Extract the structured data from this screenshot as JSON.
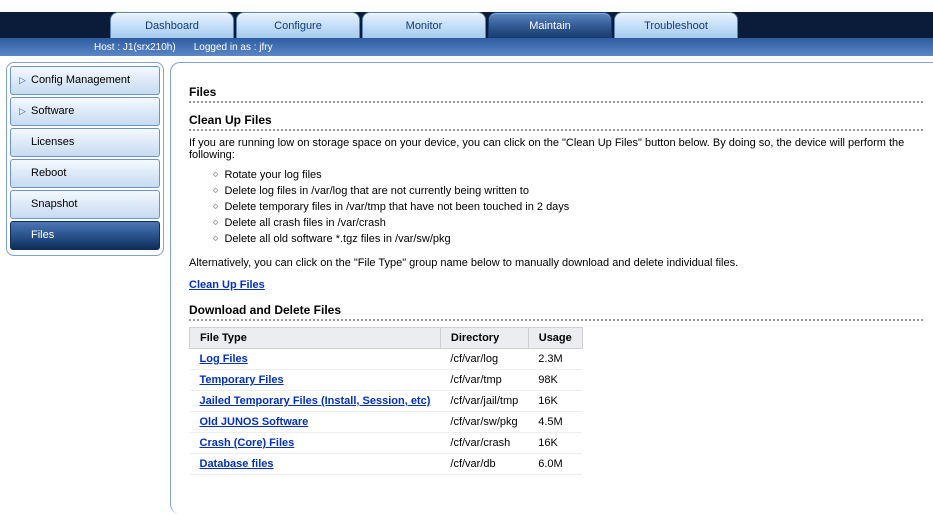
{
  "tabs": {
    "dashboard": "Dashboard",
    "configure": "Configure",
    "monitor": "Monitor",
    "maintain": "Maintain",
    "troubleshoot": "Troubleshoot"
  },
  "status": {
    "host": "Host : J1(srx210h)",
    "logged_in": "Logged in as : jfry"
  },
  "sidebar": {
    "config_mgmt": "Config Management",
    "software": "Software",
    "licenses": "Licenses",
    "reboot": "Reboot",
    "snapshot": "Snapshot",
    "files": "Files"
  },
  "page": {
    "h_files": "Files",
    "h_cleanup": "Clean Up Files",
    "intro": "If you are running low on storage space on your device, you can click on the \"Clean Up Files\" button below. By doing so, the device will perform the following:",
    "bullets": {
      "b1": "Rotate your log files",
      "b2": "Delete log files in /var/log that are not currently being written to",
      "b3": "Delete temporary files in /var/tmp that have not been touched in 2 days",
      "b4": "Delete all crash files in /var/crash",
      "b5": "Delete all old software *.tgz files in /var/sw/pkg"
    },
    "alt": "Alternatively, you can click on the \"File Type\" group name below to manually download and delete individual files.",
    "cleanup_link": "Clean Up Files",
    "h_download": "Download and Delete Files",
    "table": {
      "col_type": "File Type",
      "col_dir": "Directory",
      "col_usage": "Usage",
      "rows": [
        {
          "type": "Log Files",
          "dir": "/cf/var/log",
          "usage": "2.3M"
        },
        {
          "type": "Temporary Files",
          "dir": "/cf/var/tmp",
          "usage": "98K"
        },
        {
          "type": "Jailed Temporary Files (Install, Session, etc)",
          "dir": "/cf/var/jail/tmp",
          "usage": "16K"
        },
        {
          "type": "Old JUNOS Software",
          "dir": "/cf/var/sw/pkg",
          "usage": "4.5M"
        },
        {
          "type": "Crash (Core) Files",
          "dir": "/cf/var/crash",
          "usage": "16K"
        },
        {
          "type": "database files",
          "dir": "/cf/var/db",
          "usage": "6.0M"
        }
      ]
    }
  },
  "labels_rows": {
    "r0_type": "Log Files",
    "r0_dir": "/cf/var/log",
    "r0_usage": "2.3M",
    "r1_type": "Temporary Files",
    "r1_dir": "/cf/var/tmp",
    "r1_usage": "98K",
    "r2_type": "Jailed Temporary Files (Install, Session, etc)",
    "r2_dir": "/cf/var/jail/tmp",
    "r2_usage": "16K",
    "r3_type": "Old JUNOS Software",
    "r3_dir": "/cf/var/sw/pkg",
    "r3_usage": "4.5M",
    "r4_type": "Crash (Core) Files",
    "r4_dir": "/cf/var/crash",
    "r4_usage": "16K",
    "r5_type": "Database files",
    "r5_dir": "/cf/var/db",
    "r5_usage": "6.0M"
  }
}
